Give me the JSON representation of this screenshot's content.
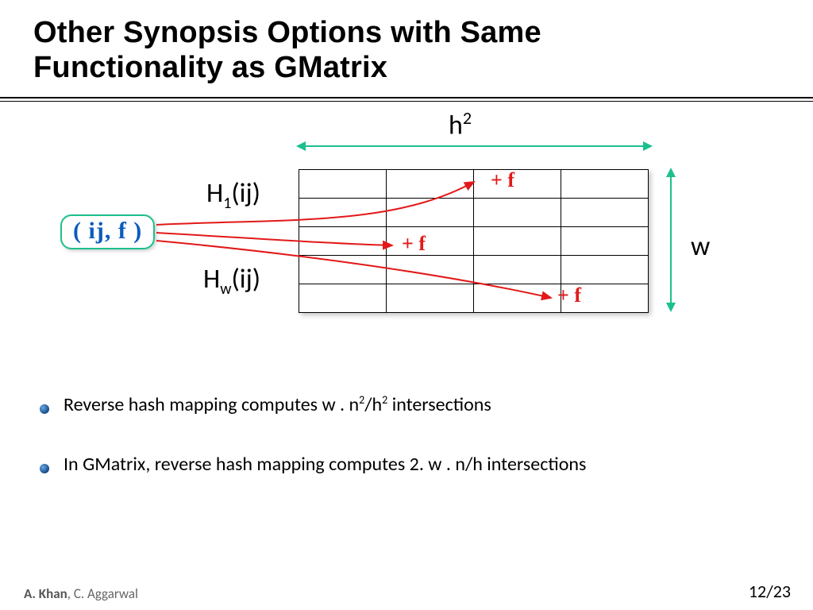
{
  "title_line1": "Other Synopsis Options with Same",
  "title_line2": "Functionality as GMatrix",
  "diagram": {
    "h2_label_base": "h",
    "h2_label_exp": "2",
    "w_label": "w",
    "h1_label_H": "H",
    "h1_label_sub": "1",
    "h1_label_arg": "(ij)",
    "hw_label_H": "H",
    "hw_label_sub": "w",
    "hw_label_arg": "(ij)",
    "ijf": "( ij, f )",
    "plus_f": "+ f"
  },
  "bullets": {
    "b1_pre": "Reverse hash mapping computes   w . n",
    "b1_sup1": "2",
    "b1_mid": "/h",
    "b1_sup2": "2",
    "b1_post": "  intersections",
    "b2": "In GMatrix, reverse hash mapping computes  2. w . n/h  intersections"
  },
  "footer": {
    "author_bold": "A. Khan",
    "author_rest": ", C. Aggarwal",
    "page": "12/23"
  }
}
